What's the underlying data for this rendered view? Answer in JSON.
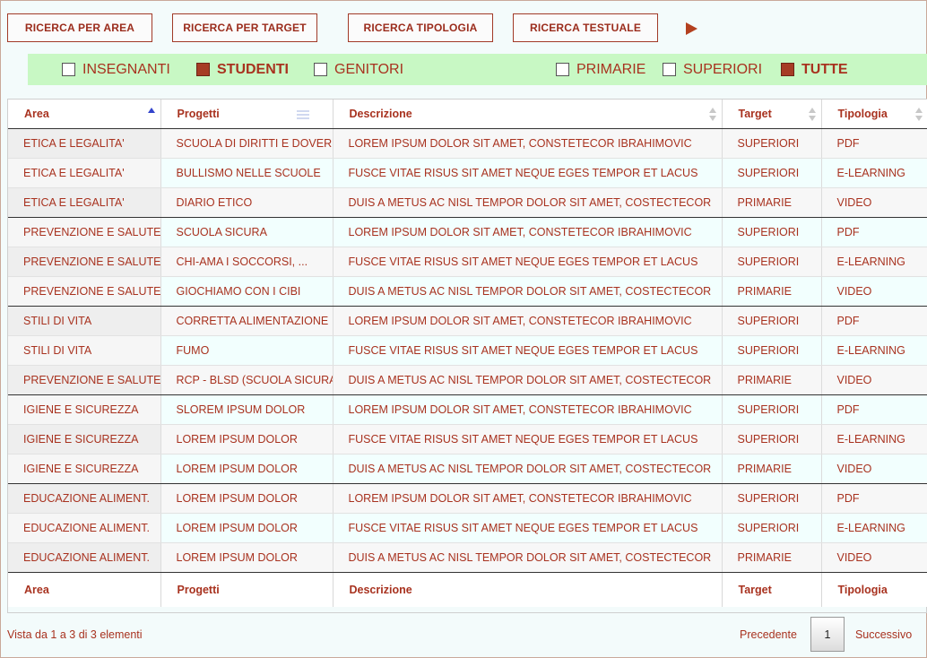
{
  "nav": {
    "buttons": [
      "RICERCA PER AREA",
      "RICERCA PER TARGET",
      "RICERCA TIPOLOGIA",
      "RICERCA TESTUALE"
    ]
  },
  "filters": {
    "target": [
      {
        "label": "INSEGNANTI",
        "checked": false
      },
      {
        "label": "STUDENTI",
        "checked": true
      },
      {
        "label": "GENITORI",
        "checked": false
      }
    ],
    "school": [
      {
        "label": "PRIMARIE",
        "checked": false
      },
      {
        "label": "SUPERIORI",
        "checked": false
      },
      {
        "label": "TUTTE",
        "checked": true
      }
    ]
  },
  "table": {
    "columns": [
      "Area",
      "Progetti",
      "Descrizione",
      "Target",
      "Tipologia"
    ],
    "rows": [
      [
        "ETICA E LEGALITA'",
        "SCUOLA DI DIRITTI E DOVERI",
        "LOREM IPSUM DOLOR SIT AMET, CONSTETECOR IBRAHIMOVIC",
        "SUPERIORI",
        "PDF"
      ],
      [
        "ETICA E LEGALITA'",
        "BULLISMO NELLE SCUOLE",
        "FUSCE VITAE RISUS SIT AMET NEQUE EGES TEMPOR ET LACUS",
        "SUPERIORI",
        "E-LEARNING"
      ],
      [
        "ETICA E LEGALITA'",
        "DIARIO ETICO",
        "DUIS A METUS AC NISL TEMPOR DOLOR SIT AMET, COSTECTECOR",
        "PRIMARIE",
        "VIDEO"
      ],
      [
        "PREVENZIONE E SALUTE",
        "SCUOLA SICURA",
        "LOREM IPSUM DOLOR SIT AMET, CONSTETECOR IBRAHIMOVIC",
        "SUPERIORI",
        "PDF"
      ],
      [
        "PREVENZIONE E SALUTE",
        "CHI-AMA I SOCCORSI, ...",
        "FUSCE VITAE RISUS SIT AMET NEQUE EGES TEMPOR ET LACUS",
        "SUPERIORI",
        "E-LEARNING"
      ],
      [
        "PREVENZIONE E SALUTE",
        "GIOCHIAMO CON I CIBI",
        "DUIS A METUS AC NISL TEMPOR DOLOR SIT AMET, COSTECTECOR",
        "PRIMARIE",
        "VIDEO"
      ],
      [
        "STILI DI VITA",
        "CORRETTA ALIMENTAZIONE",
        "LOREM IPSUM DOLOR SIT AMET, CONSTETECOR IBRAHIMOVIC",
        "SUPERIORI",
        "PDF"
      ],
      [
        "STILI DI VITA",
        "FUMO",
        "FUSCE VITAE RISUS SIT AMET NEQUE EGES TEMPOR ET LACUS",
        "SUPERIORI",
        "E-LEARNING"
      ],
      [
        "PREVENZIONE E SALUTE",
        "RCP - BLSD (SCUOLA SICURA)",
        "DUIS A METUS AC NISL TEMPOR DOLOR SIT AMET, COSTECTECOR",
        "PRIMARIE",
        "VIDEO"
      ],
      [
        "IGIENE E SICUREZZA",
        "SLOREM IPSUM DOLOR",
        "LOREM IPSUM DOLOR SIT AMET, CONSTETECOR IBRAHIMOVIC",
        "SUPERIORI",
        "PDF"
      ],
      [
        "IGIENE E SICUREZZA",
        "LOREM IPSUM DOLOR",
        "FUSCE VITAE RISUS SIT AMET NEQUE EGES TEMPOR ET LACUS",
        "SUPERIORI",
        "E-LEARNING"
      ],
      [
        "IGIENE E SICUREZZA",
        "LOREM IPSUM DOLOR",
        "DUIS A METUS AC NISL TEMPOR DOLOR SIT AMET, COSTECTECOR",
        "PRIMARIE",
        "VIDEO"
      ],
      [
        "EDUCAZIONE ALIMENT.",
        "LOREM IPSUM DOLOR",
        "LOREM IPSUM DOLOR SIT AMET, CONSTETECOR IBRAHIMOVIC",
        "SUPERIORI",
        "PDF"
      ],
      [
        "EDUCAZIONE ALIMENT.",
        "LOREM IPSUM DOLOR",
        "FUSCE VITAE RISUS SIT AMET NEQUE EGES TEMPOR ET LACUS",
        "SUPERIORI",
        "E-LEARNING"
      ],
      [
        "EDUCAZIONE ALIMENT.",
        "LOREM IPSUM DOLOR",
        "DUIS A METUS AC NISL TEMPOR DOLOR SIT AMET, COSTECTECOR",
        "PRIMARIE",
        "VIDEO"
      ]
    ]
  },
  "footer": {
    "info": "Vista da 1 a 3 di 3 elementi",
    "prev": "Precedente",
    "page": "1",
    "next": "Successivo"
  },
  "colors": {
    "accent": "#a8321f",
    "filter_bg": "#c8f8c4",
    "page_bg": "#f3fbfb"
  }
}
